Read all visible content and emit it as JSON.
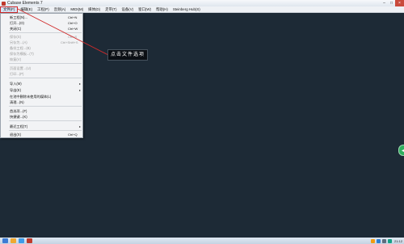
{
  "window": {
    "title": "Cubase Elements 7",
    "controls": [
      "–",
      "□",
      "×"
    ]
  },
  "menubar": {
    "items": [
      "文件(F)",
      "编辑(E)",
      "工程(P)",
      "音频(A)",
      "MIDI(M)",
      "媒体(D)",
      "走带(T)",
      "设备(V)",
      "窗口(W)",
      "帮助(H)",
      "Steinberg Hub(S)"
    ]
  },
  "file_menu": {
    "items": [
      {
        "label": "新工程(N)...",
        "shortcut": "Ctrl+N",
        "enabled": true
      },
      {
        "label": "打开...(O)",
        "shortcut": "Ctrl+O",
        "enabled": true
      },
      {
        "label": "关闭(C)",
        "shortcut": "Ctrl+W",
        "enabled": true
      },
      {
        "label": "保存(S)",
        "shortcut": "Ctrl+S",
        "enabled": false
      },
      {
        "label": "另存为...(A)",
        "shortcut": "Ctrl+Shift+S",
        "enabled": false
      },
      {
        "label": "备份工程...(B)",
        "shortcut": "",
        "enabled": false
      },
      {
        "label": "保存为模板...(T)",
        "shortcut": "",
        "enabled": false
      },
      {
        "label": "恢复(V)",
        "shortcut": "",
        "enabled": false
      },
      {
        "label": "页面设置...(U)",
        "shortcut": "",
        "enabled": false
      },
      {
        "label": "打印...(P)",
        "shortcut": "",
        "enabled": false
      },
      {
        "label": "导入(M)",
        "shortcut": "",
        "enabled": true,
        "submenu": true
      },
      {
        "label": "导出(E)",
        "shortcut": "",
        "enabled": true,
        "submenu": true
      },
      {
        "label": "在池中删除未使用的媒体(L)",
        "shortcut": "",
        "enabled": true
      },
      {
        "label": "清理...(N)",
        "shortcut": "",
        "enabled": true
      },
      {
        "label": "首选项...(F)",
        "shortcut": "",
        "enabled": true
      },
      {
        "label": "快捷键...(K)",
        "shortcut": "",
        "enabled": true
      },
      {
        "label": "最近工程(T)",
        "shortcut": "",
        "enabled": true,
        "submenu": true
      },
      {
        "label": "退出(X)",
        "shortcut": "Ctrl+Q",
        "enabled": true
      }
    ]
  },
  "annotation": {
    "text": "点击文件选项",
    "color": "#d12b2b"
  },
  "side_knob": {
    "glyph": "◀"
  },
  "taskbar": {
    "time": "21:12"
  },
  "colors": {
    "workspace": "#1d2a36",
    "accent": "#d12b2b"
  }
}
